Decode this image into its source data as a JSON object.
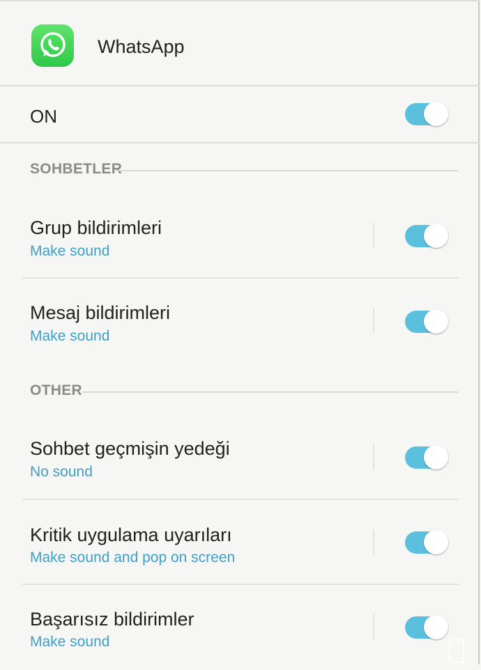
{
  "app": {
    "name": "WhatsApp",
    "icon": "whatsapp-icon",
    "icon_color": "#34c84a"
  },
  "master": {
    "label": "ON",
    "enabled": true
  },
  "accent": "#5bc0de",
  "subtext_color": "#3f9fc7",
  "sections": [
    {
      "title": "SOHBETLER",
      "items": [
        {
          "title": "Grup bildirimleri",
          "subtitle": "Make sound",
          "enabled": true
        },
        {
          "title": "Mesaj bildirimleri",
          "subtitle": "Make sound",
          "enabled": true
        }
      ]
    },
    {
      "title": "OTHER",
      "items": [
        {
          "title": "Sohbet geçmişin yedeği",
          "subtitle": "No sound",
          "enabled": true
        },
        {
          "title": "Kritik uygulama uyarıları",
          "subtitle": "Make sound and pop on screen",
          "enabled": true
        },
        {
          "title": "Başarısız bildirimler",
          "subtitle": "Make sound",
          "enabled": true
        }
      ]
    }
  ]
}
